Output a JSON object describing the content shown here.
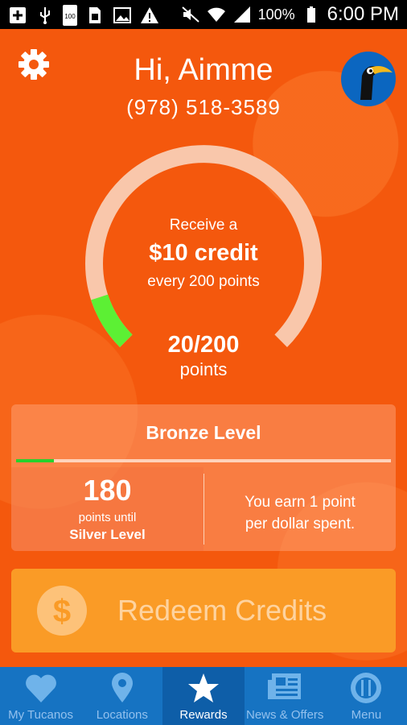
{
  "status_bar": {
    "battery_percent": "100%",
    "time": "6:00 PM",
    "battery_badge": "100",
    "icons": [
      "add-icon",
      "usb-icon",
      "battery-badge-icon",
      "sim-icon",
      "image-icon",
      "warning-icon",
      "mute-icon",
      "wifi-icon",
      "signal-icon",
      "battery-icon"
    ]
  },
  "header": {
    "greeting": "Hi, Aimme",
    "phone": "(978) 518-3589"
  },
  "gauge": {
    "line1": "Receive a",
    "credit": "$10 credit",
    "line3": "every 200 points",
    "points_value": "20/200",
    "points_label": "points",
    "progress_fraction": 0.1,
    "colors": {
      "track": "#f9c7ab",
      "fill": "#5cf034"
    }
  },
  "level_card": {
    "title": "Bronze Level",
    "progress_fraction": 0.1,
    "points_until_value": "180",
    "points_until_label": "points until",
    "next_level": "Silver Level",
    "earn_line1": "You earn 1 point",
    "earn_line2": "per dollar spent."
  },
  "redeem": {
    "label": "Redeem Credits",
    "icon": "dollar-coin-icon"
  },
  "nav": {
    "items": [
      {
        "label": "My Tucanos",
        "icon": "heart-icon"
      },
      {
        "label": "Locations",
        "icon": "location-pin-icon"
      },
      {
        "label": "Rewards",
        "icon": "star-icon"
      },
      {
        "label": "News & Offers",
        "icon": "newspaper-icon"
      },
      {
        "label": "Menu",
        "icon": "plate-icon"
      }
    ],
    "active": "Rewards"
  },
  "colors": {
    "background": "#f4580d",
    "nav": "#1673c2",
    "redeem": "#fa9b26",
    "progress": "#27d12c"
  }
}
